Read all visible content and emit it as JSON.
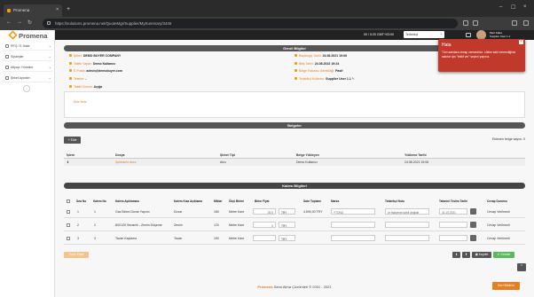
{
  "browser": {
    "tab_title": "Promena",
    "url": "https://solutions.promena.net/QuoteMgr/Supplier/MySummary/3445"
  },
  "sidebar": {
    "logo": "Promena",
    "items": [
      {
        "label": "RFQ / E-İhale",
        "icon": "rfq-icon"
      },
      {
        "label": "Siparişler",
        "icon": "orders-icon"
      },
      {
        "label": "Altyapı Yönetimi",
        "icon": "infrastructure-icon"
      },
      {
        "label": "Şirket Ayarları",
        "icon": "settings-icon"
      }
    ]
  },
  "topbar": {
    "timezone": "00 / 0:20 GMT+03:00",
    "role_select": "Tedarikçi",
    "user_name": "Mert Kaba",
    "user_role": "Supplier User 1.1"
  },
  "general": {
    "title": "Genel Bilgiler",
    "left": [
      {
        "label": "Şirket:",
        "value": "DEMO BUYER COMPANY"
      },
      {
        "label": "Talebi Yapan:",
        "value": "Demo Kullanıcı"
      },
      {
        "label": "E-Posta:",
        "value": "admin@demobuyer.com"
      },
      {
        "label": "Telefon:",
        "value": "-"
      },
      {
        "label": "Talebi Durum:",
        "value": "Açığa"
      }
    ],
    "right": [
      {
        "label": "Başlangıç Tarihi:",
        "value": "24.08.2021 19:06"
      },
      {
        "label": "Bitiş Tarihi:",
        "value": "24.08.2022 19:24"
      },
      {
        "label": "Bölge Faturası Gerekliliği:",
        "value": "Pasif"
      },
      {
        "label": "Tedarikçi Kullanıcı:",
        "value": "Supplier User 1.1"
      }
    ],
    "note": "Ekic Notu"
  },
  "documents": {
    "title": "Belgeler",
    "add_label": "Ekle",
    "size_label": "Eklenen belge sayısı: 0",
    "headers": [
      "İşlem",
      "Dosya",
      "Şirket Tipi",
      "Belge Yükleyen",
      "Yükleme Tarihi"
    ],
    "rows": [
      [
        "",
        "Şartname.docx",
        "Alıcı",
        "Demo Kullanıcı",
        "24.08.2021 19:06"
      ]
    ]
  },
  "items": {
    "title": "Kalem Bilgileri",
    "headers": [
      "Sıra No",
      "Kalem No",
      "Kalem Açıklaması",
      "Kalem Kısa Açıklama",
      "Miktar",
      "Ölçü Birimi",
      "Birim Fiyat",
      "Satır Toplamı",
      "Marka",
      "Tedarikçi Notu",
      "Tahmini Teslim Tarihi",
      "Cevap Durumu"
    ],
    "rows": [
      {
        "sira": "1",
        "kalem": "1",
        "aciklama": "Gaz Beton Duvar Yapımı",
        "kisa": "Duvar",
        "miktar": "180",
        "birim": "Metre Kare",
        "fiyat": "25,5",
        "para": "TRY",
        "toplam": "4.590,00 TRY",
        "marka": "YTONG",
        "not": "ör malzeme dahil değildir",
        "tarih": "31.10.2021",
        "durum": "Cevap Verilmedi"
      },
      {
        "sira": "2",
        "kalem": "2",
        "aciklama": "80X120 Seramik - Zemin Döşeme",
        "kisa": "Zemin",
        "miktar": "120",
        "birim": "Metre Kare",
        "fiyat": "0",
        "para": "TRY",
        "toplam": "",
        "marka": "",
        "not": "",
        "tarih": "",
        "durum": "Cevap Verilmedi"
      },
      {
        "sira": "3",
        "kalem": "3",
        "aciklama": "Tavan Kaplama",
        "kisa": "Tavan",
        "miktar": "150",
        "birim": "Metre Kare",
        "fiyat": "",
        "para": "TRY",
        "toplam": "",
        "marka": "",
        "not": "",
        "tarih": "",
        "durum": "Cevap Verilmedi"
      }
    ],
    "bulk_label": "Toplu Fiyat",
    "save_label": "Kaydet",
    "send_label": "Gönder"
  },
  "footer": {
    "brand": "Promena",
    "text": "Satın Alma Çözümleri © 2001 - 2021",
    "feedback": "Geri Bildirim"
  },
  "toast": {
    "title": "Hata",
    "message": "Tüm satırlara cevap vermediniz. Lütfen kalıl vermediğiniz satırlar için \"teklif ver\" seçimi yapınız."
  },
  "colors": {
    "accent": "#e67e22",
    "header": "#555555",
    "error": "#c0392b"
  }
}
